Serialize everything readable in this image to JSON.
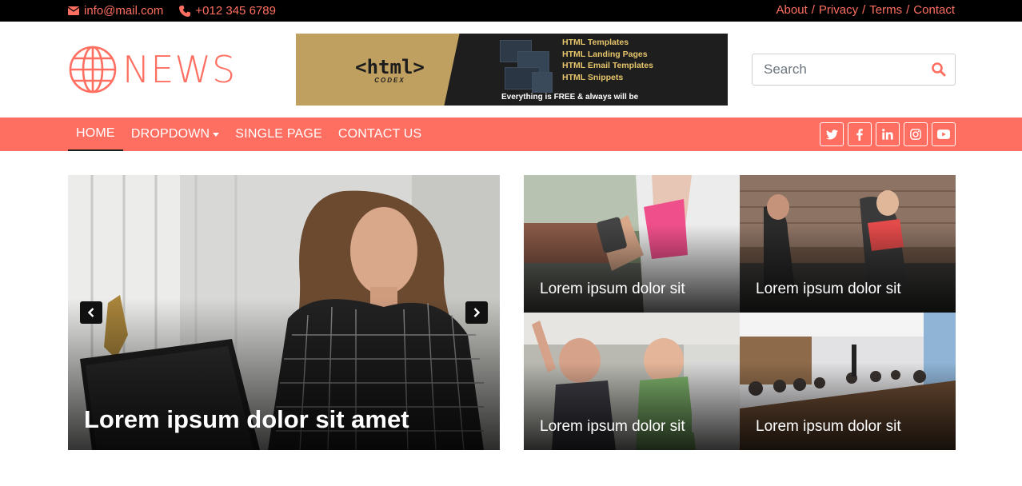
{
  "topbar": {
    "email": "info@mail.com",
    "phone": "+012 345 6789",
    "links": [
      "About",
      "Privacy",
      "Terms",
      "Contact"
    ],
    "separator": "/"
  },
  "header": {
    "logo_text": "NEWS",
    "banner": {
      "brand": "<html>",
      "brand_sub": "CODEX",
      "items": [
        "HTML Templates",
        "HTML Landing Pages",
        "HTML Email Templates",
        "HTML Snippets"
      ],
      "tagline": "Everything is FREE & always will be"
    },
    "search": {
      "placeholder": "Search",
      "value": ""
    }
  },
  "nav": {
    "items": [
      {
        "label": "HOME",
        "active": true
      },
      {
        "label": "DROPDOWN",
        "dropdown": true
      },
      {
        "label": "SINGLE PAGE"
      },
      {
        "label": "CONTACT US"
      }
    ],
    "social_icons": [
      "twitter-icon",
      "facebook-icon",
      "linkedin-icon",
      "instagram-icon",
      "youtube-icon"
    ]
  },
  "carousel": {
    "title": "Lorem ipsum dolor sit amet"
  },
  "tiles": [
    {
      "title": "Lorem ipsum dolor sit"
    },
    {
      "title": "Lorem ipsum dolor sit"
    },
    {
      "title": "Lorem ipsum dolor sit"
    },
    {
      "title": "Lorem ipsum dolor sit"
    }
  ],
  "colors": {
    "accent": "#FF6F61",
    "topbar_bg": "#000000",
    "banner_gold": "#C0A060"
  }
}
